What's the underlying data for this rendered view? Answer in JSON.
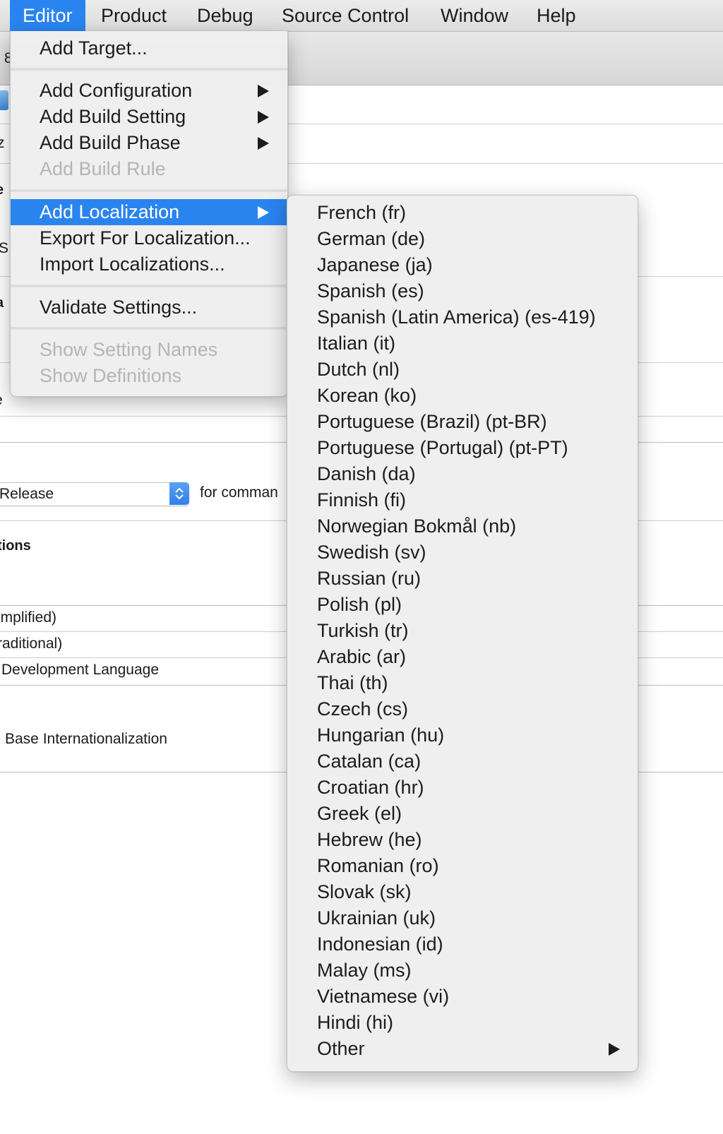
{
  "menubar": {
    "items": [
      {
        "label": "Editor",
        "active": true
      },
      {
        "label": "Product"
      },
      {
        "label": "Debug"
      },
      {
        "label": "Source Control"
      },
      {
        "label": "Window"
      },
      {
        "label": "Help"
      }
    ]
  },
  "editor_menu": {
    "items": [
      {
        "label": "Add Target...",
        "enabled": true
      },
      {
        "label": "Add Configuration",
        "enabled": true,
        "submenu": true
      },
      {
        "label": "Add Build Setting",
        "enabled": true,
        "submenu": true
      },
      {
        "label": "Add Build Phase",
        "enabled": true,
        "submenu": true
      },
      {
        "label": "Add Build Rule",
        "enabled": false
      },
      {
        "label": "Add Localization",
        "enabled": true,
        "submenu": true,
        "highlighted": true
      },
      {
        "label": "Export For Localization...",
        "enabled": true
      },
      {
        "label": "Import Localizations...",
        "enabled": true
      },
      {
        "label": "Validate Settings...",
        "enabled": true
      },
      {
        "label": "Show Setting Names",
        "enabled": false
      },
      {
        "label": "Show Definitions",
        "enabled": false
      }
    ]
  },
  "localization_menu": {
    "items": [
      "French (fr)",
      "German (de)",
      "Japanese (ja)",
      "Spanish (es)",
      "Spanish (Latin America) (es-419)",
      "Italian (it)",
      "Dutch (nl)",
      "Korean (ko)",
      "Portuguese (Brazil) (pt-BR)",
      "Portuguese (Portugal) (pt-PT)",
      "Danish (da)",
      "Finnish (fi)",
      "Norwegian Bokmål (nb)",
      "Swedish (sv)",
      "Russian (ru)",
      "Polish (pl)",
      "Turkish (tr)",
      "Arabic (ar)",
      "Thai (th)",
      "Czech (cs)",
      "Hungarian (hu)",
      "Catalan (ca)",
      "Croatian (hr)",
      "Greek (el)",
      "Hebrew (he)",
      "Romanian (ro)",
      "Slovak (sk)",
      "Ukrainian (uk)",
      "Indonesian (id)",
      "Malay (ms)",
      "Vietnamese (vi)",
      "Hindi (hi)"
    ],
    "other_label": "Other"
  },
  "background": {
    "fragments": [
      "8",
      "z",
      "e",
      "S",
      "a",
      "e"
    ],
    "build_config_value": "Release",
    "build_config_suffix": "for comman",
    "section_heading": "tions",
    "localization_rows": [
      "implified)",
      "raditional)",
      "Development Language"
    ],
    "base_internationalization": "Base Internationalization"
  },
  "colors": {
    "highlight": "#2a84f0",
    "menu_bg": "#eeeeee",
    "disabled_text": "#b5b5b5"
  }
}
